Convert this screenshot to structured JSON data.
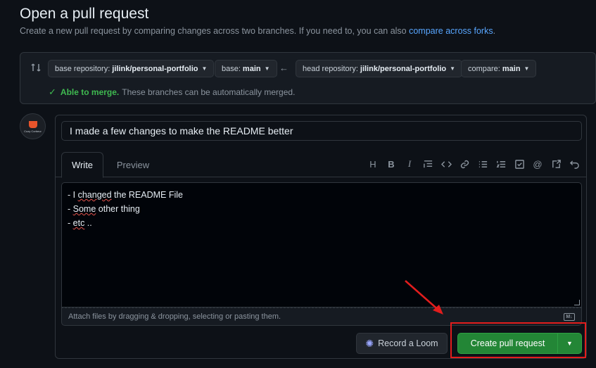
{
  "header": {
    "title": "Open a pull request",
    "subtitle": "Create a new pull request by comparing changes across two branches. If you need to, you can also",
    "subtitle_link": "compare across forks",
    "subtitle_end": "."
  },
  "compare": {
    "base_repo_label": "base repository:",
    "base_repo_value": "jilink/personal-portfolio",
    "base_label": "base:",
    "base_value": "main",
    "head_repo_label": "head repository:",
    "head_repo_value": "jilink/personal-portfolio",
    "compare_label": "compare:",
    "compare_value": "main",
    "merge_ok": "Able to merge.",
    "merge_msg": "These branches can be automatically merged."
  },
  "avatar": {
    "text": "Cozy Corbeur"
  },
  "form": {
    "title_value": "I made a few changes to make the README better",
    "tabs": [
      "Write",
      "Preview"
    ],
    "body_lines": [
      {
        "pre": "- I ",
        "err": "changed",
        "post": " the README File"
      },
      {
        "pre": "- ",
        "err": "Some",
        "post": " other thing"
      },
      {
        "pre": "- ",
        "err": "etc",
        "post": " .."
      }
    ],
    "attach_text": "Attach files by dragging & dropping, selecting or pasting them.",
    "md_badge": "M↓",
    "loom_label": "Record a Loom",
    "create_label": "Create pull request"
  },
  "toolbar_icons": [
    "heading-icon",
    "bold-icon",
    "italic-icon",
    "quote-icon",
    "code-icon",
    "link-icon",
    "unordered-list-icon",
    "ordered-list-icon",
    "task-list-icon",
    "mention-icon",
    "reference-icon",
    "undo-icon"
  ],
  "colors": {
    "accent_link": "#58a6ff",
    "success": "#3fb950",
    "primary_button": "#238636",
    "annotation_red": "#e21d1d"
  }
}
